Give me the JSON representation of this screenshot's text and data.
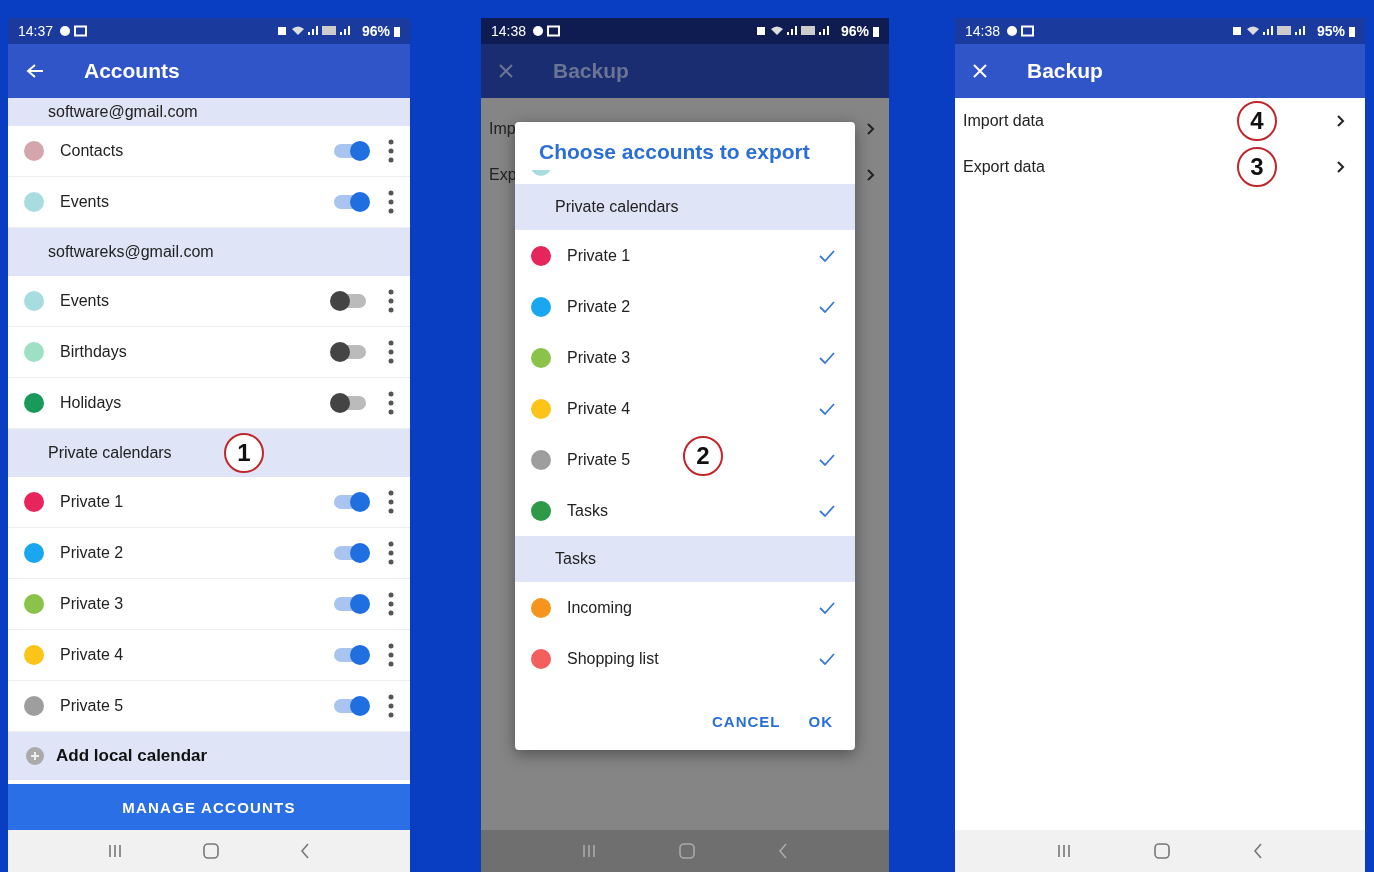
{
  "accounts_screen": {
    "status": {
      "time": "14:37",
      "battery": "96%"
    },
    "title": "Accounts",
    "list": [
      {
        "kind": "header",
        "label": "software@gmail.com"
      },
      {
        "kind": "calendar",
        "label": "Contacts",
        "color": "#d4a5ab",
        "on": true
      },
      {
        "kind": "calendar",
        "label": "Events",
        "color": "#a8dde0",
        "on": true
      },
      {
        "kind": "header",
        "label": "softwareks@gmail.com"
      },
      {
        "kind": "calendar",
        "label": "Events",
        "color": "#a8dde0",
        "on": false
      },
      {
        "kind": "calendar",
        "label": "Birthdays",
        "color": "#9ee0c5",
        "on": false
      },
      {
        "kind": "calendar",
        "label": "Holidays",
        "color": "#1a9a5a",
        "on": false
      },
      {
        "kind": "header",
        "label": "Private calendars",
        "annotation": "1"
      },
      {
        "kind": "calendar",
        "label": "Private 1",
        "color": "#e8245c",
        "on": true
      },
      {
        "kind": "calendar",
        "label": "Private 2",
        "color": "#1aa7ef",
        "on": true
      },
      {
        "kind": "calendar",
        "label": "Private 3",
        "color": "#8bc34a",
        "on": true
      },
      {
        "kind": "calendar",
        "label": "Private 4",
        "color": "#fcc419",
        "on": true
      },
      {
        "kind": "calendar",
        "label": "Private 5",
        "color": "#9e9e9e",
        "on": true
      }
    ],
    "add_label": "Add local calendar",
    "manage_button": "MANAGE ACCOUNTS"
  },
  "export_screen": {
    "status": {
      "time": "14:38",
      "battery": "96%"
    },
    "title": "Backup",
    "background_items": [
      "Imp",
      "Exp"
    ],
    "dialog": {
      "title": "Choose accounts to export",
      "annotation": "2",
      "items": [
        {
          "kind": "partial",
          "color": "#a8dde0"
        },
        {
          "kind": "header",
          "label": "Private calendars"
        },
        {
          "kind": "calendar",
          "label": "Private 1",
          "color": "#e8245c",
          "checked": true
        },
        {
          "kind": "calendar",
          "label": "Private 2",
          "color": "#1aa7ef",
          "checked": true
        },
        {
          "kind": "calendar",
          "label": "Private 3",
          "color": "#8bc34a",
          "checked": true
        },
        {
          "kind": "calendar",
          "label": "Private 4",
          "color": "#fcc419",
          "checked": true
        },
        {
          "kind": "calendar",
          "label": "Private 5",
          "color": "#9e9e9e",
          "checked": true
        },
        {
          "kind": "calendar",
          "label": "Tasks",
          "color": "#2e9a48",
          "checked": true
        },
        {
          "kind": "header",
          "label": "Tasks"
        },
        {
          "kind": "calendar",
          "label": "Incoming",
          "color": "#f7941d",
          "checked": true
        },
        {
          "kind": "calendar",
          "label": "Shopping list",
          "color": "#f25f5c",
          "checked": true
        }
      ],
      "cancel": "CANCEL",
      "ok": "OK"
    }
  },
  "backup_screen": {
    "status": {
      "time": "14:38",
      "battery": "95%"
    },
    "title": "Backup",
    "items": [
      {
        "label": "Import data",
        "annotation": "4"
      },
      {
        "label": "Export data",
        "annotation": "3"
      }
    ]
  }
}
